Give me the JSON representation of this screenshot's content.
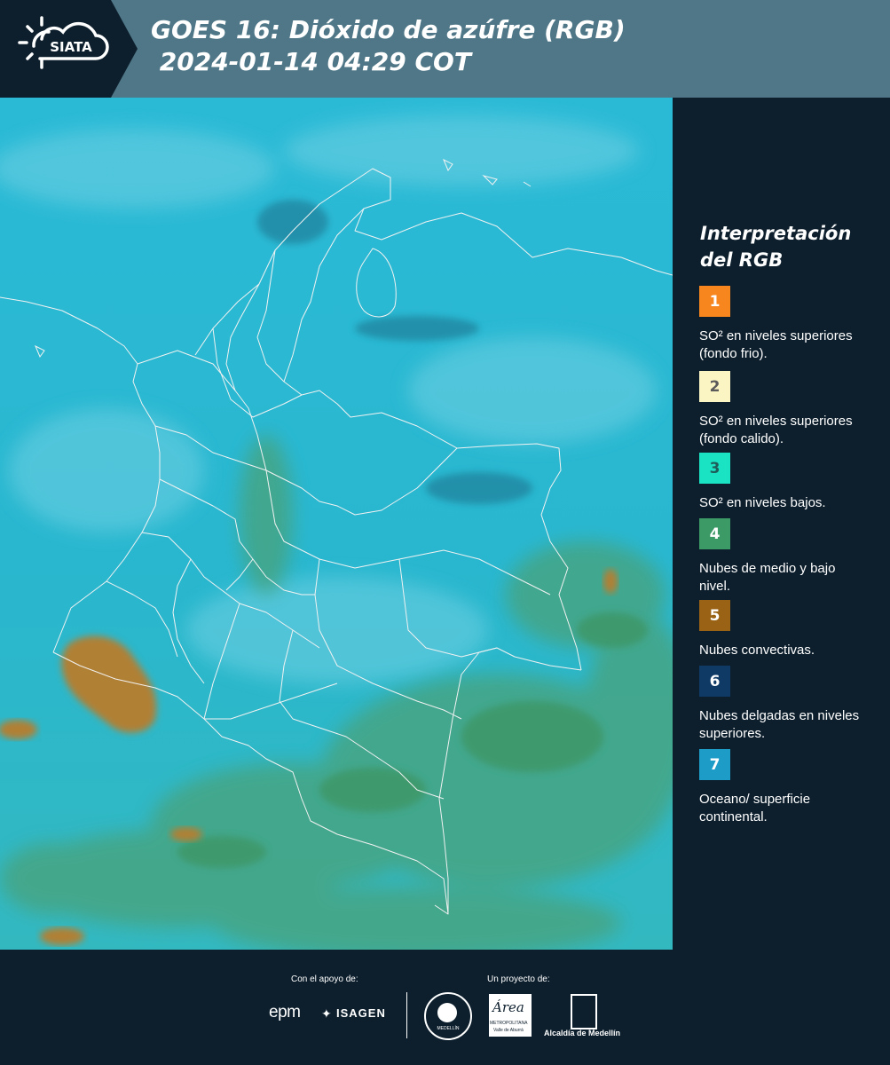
{
  "header": {
    "logo_text": "SIATA",
    "title_line1": "GOES 16: Dióxido de azúfre (RGB)",
    "title_line2": " 2024-01-14 04:29 COT"
  },
  "legend": {
    "title": "Interpretación del RGB",
    "items": [
      {
        "number": "1",
        "label": "SO² en niveles superiores (fondo frio).",
        "color": "#f7861f",
        "text_color": "#ffffff"
      },
      {
        "number": "2",
        "label": "SO² en niveles superiores (fondo calido).",
        "color": "#fbf5c3",
        "text_color": "#5a5a5a"
      },
      {
        "number": "3",
        "label": "SO² en niveles bajos.",
        "color": "#19e3c3",
        "text_color": "#1f5d5a"
      },
      {
        "number": "4",
        "label": "Nubes de medio y bajo nivel.",
        "color": "#3b9a66",
        "text_color": "#ffffff"
      },
      {
        "number": "5",
        "label": "Nubes convectivas.",
        "color": "#9a6215",
        "text_color": "#ffffff"
      },
      {
        "number": "6",
        "label": "Nubes delgadas en niveles superiores.",
        "color": "#0f3a66",
        "text_color": "#ffffff"
      },
      {
        "number": "7",
        "label": "Oceano/ superficie continental.",
        "color": "#1e9cc8",
        "text_color": "#ffffff"
      }
    ]
  },
  "footer": {
    "support_label": "Con el apoyo de:",
    "project_label": "Un proyecto de:",
    "sponsor_1": "epm",
    "sponsor_2": "ISAGEN",
    "partner_1": "MEDELLÍN",
    "partner_2_script": "Área",
    "partner_2_sub1": "METROPOLITANA",
    "partner_2_sub2": "Valle de Aburrá",
    "partner_3": "Alcaldía de Medellín"
  }
}
